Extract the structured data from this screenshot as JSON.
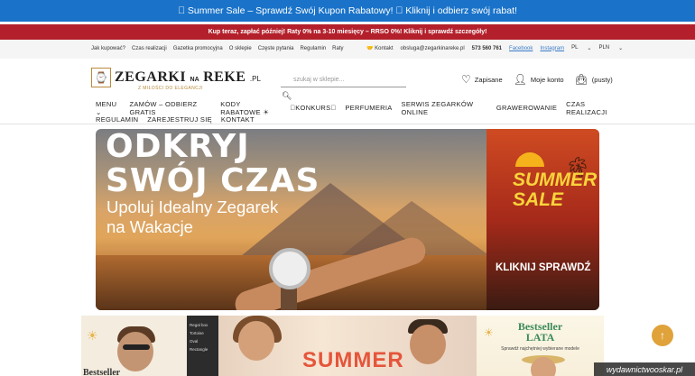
{
  "topbar": {
    "text": "􀀀 Summer Sale – Sprawdź Swój Kupon Rabatowy! 􀀀 Kliknij i odbierz swój rabat!"
  },
  "redbar": {
    "text": "Kup teraz, zapłać później! Raty 0% na 3-10 miesięcy – RRSO 0%! Kliknij i sprawdź szczegóły!"
  },
  "utility": {
    "links": [
      "Jak kupować?",
      "Czas realizacji",
      "Gazetka promocyjna",
      "O sklepie",
      "Częste pytania",
      "Regulamin",
      "Raty"
    ],
    "contact_label": "Kontakt",
    "email": "obsluga@zegarkinareke.pl",
    "phone": "573 560 761",
    "facebook": "Facebook",
    "instagram": "Instagram",
    "language": "PL",
    "currency": "PLN"
  },
  "header": {
    "logo_main": "ZEGARKI",
    "logo_na": "NA",
    "logo_reke": "REKE",
    "logo_tld": ".PL",
    "logo_sub": "Z MIŁOŚCI DO ELEGANCJI",
    "search_placeholder": "szukaj w sklepie...",
    "saved": "Zapisane",
    "account": "Moje konto",
    "cart": "(pusty)"
  },
  "nav": {
    "row1": [
      "MENU ⌄",
      "ZAMÓW – ODBIERZ GRATIS",
      "KODY RABATOWE ☀",
      "􀀀KONKURS􀀀",
      "PERFUMERIA",
      "SERWIS ZEGARKÓW ONLINE",
      "GRAWEROWANIE",
      "CZAS REALIZACJI"
    ],
    "row2": [
      "REGULAMIN",
      "ZAREJESTRUJ SIĘ",
      "KONTAKT"
    ]
  },
  "hero": {
    "title_line1": "ODKRYJ",
    "title_line2": "SWÓJ CZAS",
    "subtitle_line1": "Upoluj Idealny Zegarek",
    "subtitle_line2": "na Wakacje",
    "sale_line1": "SUMMER",
    "sale_line2": "SALE",
    "cta": "KLIKNIJ SPRAWDŹ"
  },
  "tiles": {
    "tile1_label": "Bestseller",
    "tile1_box": [
      "Regal box",
      "Tortoise",
      "Oval",
      "Rectangle"
    ],
    "tile2_label": "SUMMER",
    "tile3_line1": "Bestseller",
    "tile3_line2": "LATA",
    "tile3_sub": "Sprawdź najchętniej wybierane modele"
  },
  "watermark": "wydawnictwooskar.pl",
  "colors": {
    "topbar": "#1a73c9",
    "redbar": "#b3202b",
    "accent_gold": "#b88a3b",
    "fab": "#e0a23a"
  }
}
